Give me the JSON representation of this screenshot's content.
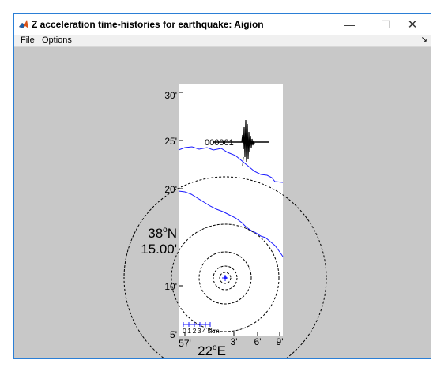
{
  "window": {
    "title": "Z acceleration time-histories for earthquake: Aigion",
    "minimize_glyph": "—",
    "maximize_glyph": "☐",
    "close_glyph": "✕"
  },
  "menu": {
    "file": "File",
    "options": "Options",
    "dock_glyph": "↘"
  },
  "map": {
    "lat_ticks": [
      "30'",
      "25'",
      "20'",
      "10'",
      "5'"
    ],
    "lat_center_deg": "38",
    "lat_center_hemi": "N",
    "lat_center_min": "15.00'",
    "lon_ticks": [
      "57'",
      "3'",
      "6'",
      "9'"
    ],
    "lon_center_deg": "22",
    "lon_center_hemi": "E",
    "degree_symbol": "o",
    "station_label": "000001",
    "scale_label": "0 1 2 3 4 5km",
    "coast_color": "#1a1aff",
    "epicenter_color": "#1a1aff"
  }
}
